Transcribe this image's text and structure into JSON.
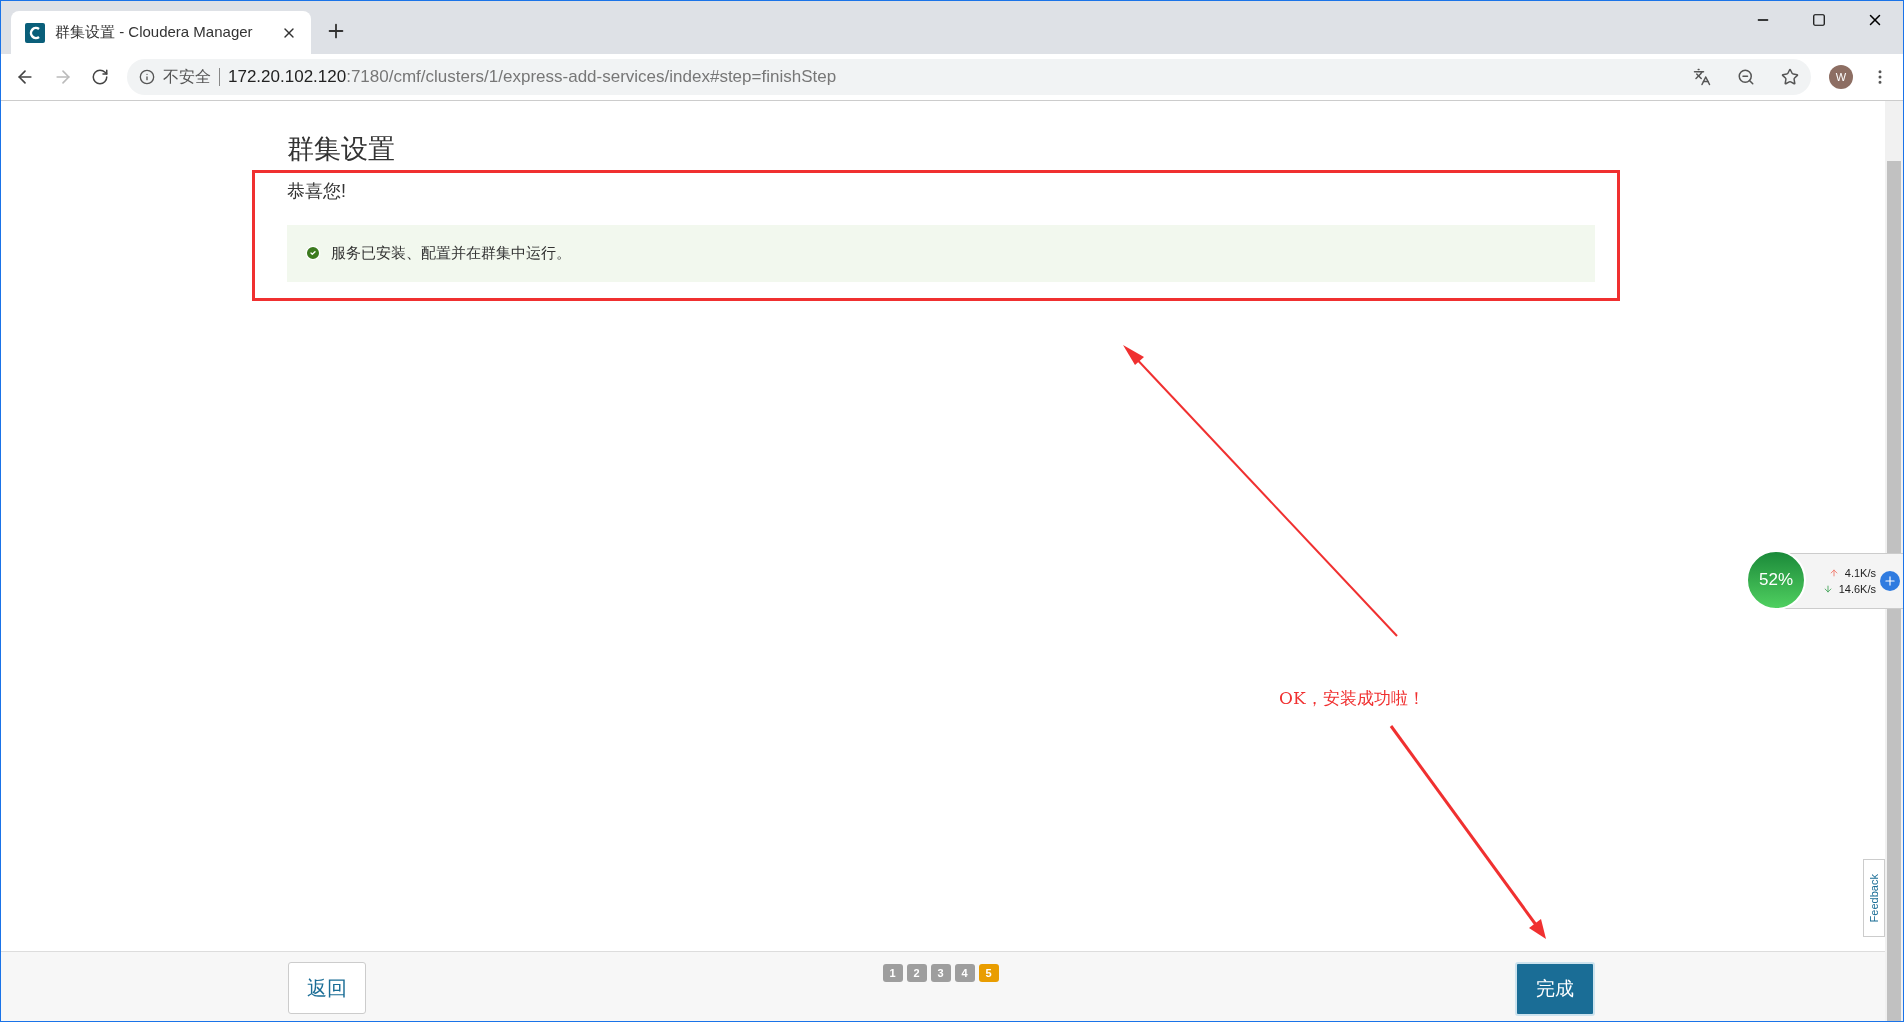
{
  "browser": {
    "tab_title": "群集设置 - Cloudera Manager",
    "security": "不安全",
    "url_host": "172.20.102.120",
    "url_path": ":7180/cmf/clusters/1/express-add-services/index#step=finishStep",
    "avatar": "W"
  },
  "page": {
    "title": "群集设置",
    "congrats": "恭喜您!",
    "message": "服务已安装、配置并在群集中运行。"
  },
  "footer": {
    "back": "返回",
    "finish": "完成",
    "steps": [
      {
        "label": "1",
        "selected": false
      },
      {
        "label": "2",
        "selected": false
      },
      {
        "label": "3",
        "selected": false
      },
      {
        "label": "4",
        "selected": false
      },
      {
        "label": "5",
        "selected": true
      }
    ]
  },
  "annotation": {
    "text": "OK，安装成功啦！"
  },
  "net_widget": {
    "percent": "52%",
    "upload": "4.1K/s",
    "download": "14.6K/s"
  },
  "feedback": "Feedback"
}
